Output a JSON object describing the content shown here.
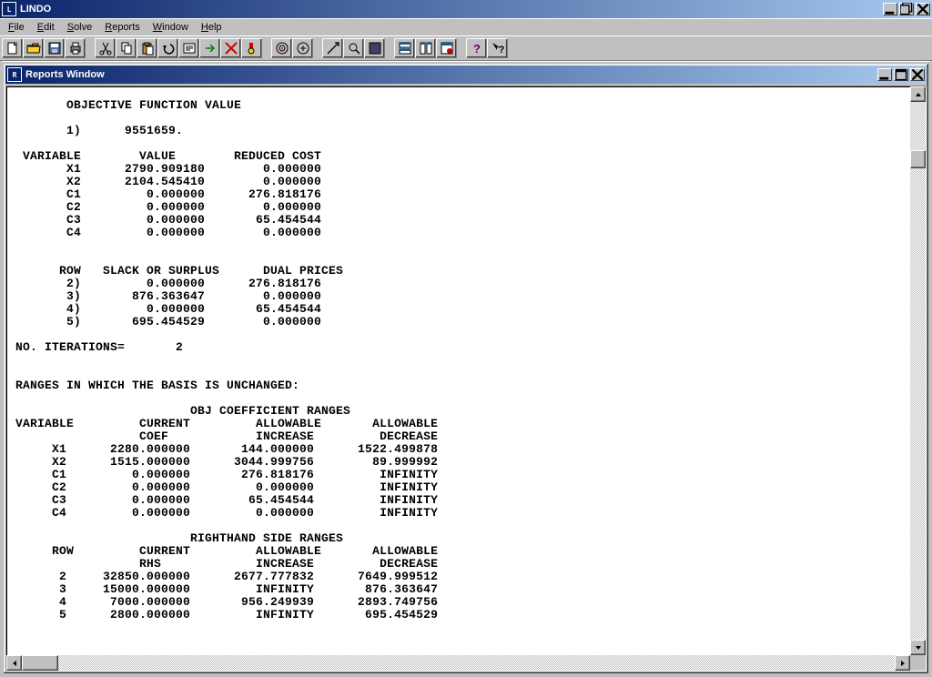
{
  "app": {
    "title": "LINDO"
  },
  "menus": {
    "file": "File",
    "edit": "Edit",
    "solve": "Solve",
    "reports": "Reports",
    "window": "Window",
    "help": "Help"
  },
  "inner": {
    "title": "Reports Window"
  },
  "report": {
    "objHeader": "OBJECTIVE FUNCTION VALUE",
    "objRow": "1)",
    "objValue": "9551659.",
    "varHeader": {
      "c1": "VARIABLE",
      "c2": "VALUE",
      "c3": "REDUCED COST"
    },
    "vars": [
      {
        "n": "X1",
        "v": "2790.909180",
        "r": "0.000000"
      },
      {
        "n": "X2",
        "v": "2104.545410",
        "r": "0.000000"
      },
      {
        "n": "C1",
        "v": "0.000000",
        "r": "276.818176"
      },
      {
        "n": "C2",
        "v": "0.000000",
        "r": "0.000000"
      },
      {
        "n": "C3",
        "v": "0.000000",
        "r": "65.454544"
      },
      {
        "n": "C4",
        "v": "0.000000",
        "r": "0.000000"
      }
    ],
    "rowHeader": {
      "c1": "ROW",
      "c2": "SLACK OR SURPLUS",
      "c3": "DUAL PRICES"
    },
    "rows": [
      {
        "n": "2)",
        "v": "0.000000",
        "r": "276.818176"
      },
      {
        "n": "3)",
        "v": "876.363647",
        "r": "0.000000"
      },
      {
        "n": "4)",
        "v": "0.000000",
        "r": "65.454544"
      },
      {
        "n": "5)",
        "v": "695.454529",
        "r": "0.000000"
      }
    ],
    "iterLabel": "NO. ITERATIONS=",
    "iterValue": "2",
    "rangesHeader": "RANGES IN WHICH THE BASIS IS UNCHANGED:",
    "objCoefTitle": "OBJ COEFFICIENT RANGES",
    "rangeHdr1": {
      "c1": "VARIABLE",
      "c2": "CURRENT",
      "c3": "ALLOWABLE",
      "c4": "ALLOWABLE"
    },
    "rangeHdr2": {
      "c2": "COEF",
      "c3": "INCREASE",
      "c4": "DECREASE"
    },
    "objRanges": [
      {
        "n": "X1",
        "c": "2280.000000",
        "i": "144.000000",
        "d": "1522.499878"
      },
      {
        "n": "X2",
        "c": "1515.000000",
        "i": "3044.999756",
        "d": "89.999992"
      },
      {
        "n": "C1",
        "c": "0.000000",
        "i": "276.818176",
        "d": "INFINITY"
      },
      {
        "n": "C2",
        "c": "0.000000",
        "i": "0.000000",
        "d": "INFINITY"
      },
      {
        "n": "C3",
        "c": "0.000000",
        "i": "65.454544",
        "d": "INFINITY"
      },
      {
        "n": "C4",
        "c": "0.000000",
        "i": "0.000000",
        "d": "INFINITY"
      }
    ],
    "rhsTitle": "RIGHTHAND SIDE RANGES",
    "rhsHdr1": {
      "c1": "ROW",
      "c2": "CURRENT",
      "c3": "ALLOWABLE",
      "c4": "ALLOWABLE"
    },
    "rhsHdr2": {
      "c2": "RHS",
      "c3": "INCREASE",
      "c4": "DECREASE"
    },
    "rhsRanges": [
      {
        "n": "2",
        "c": "32850.000000",
        "i": "2677.777832",
        "d": "7649.999512"
      },
      {
        "n": "3",
        "c": "15000.000000",
        "i": "INFINITY",
        "d": "876.363647"
      },
      {
        "n": "4",
        "c": "7000.000000",
        "i": "956.249939",
        "d": "2893.749756"
      },
      {
        "n": "5",
        "c": "2800.000000",
        "i": "INFINITY",
        "d": "695.454529"
      }
    ]
  }
}
